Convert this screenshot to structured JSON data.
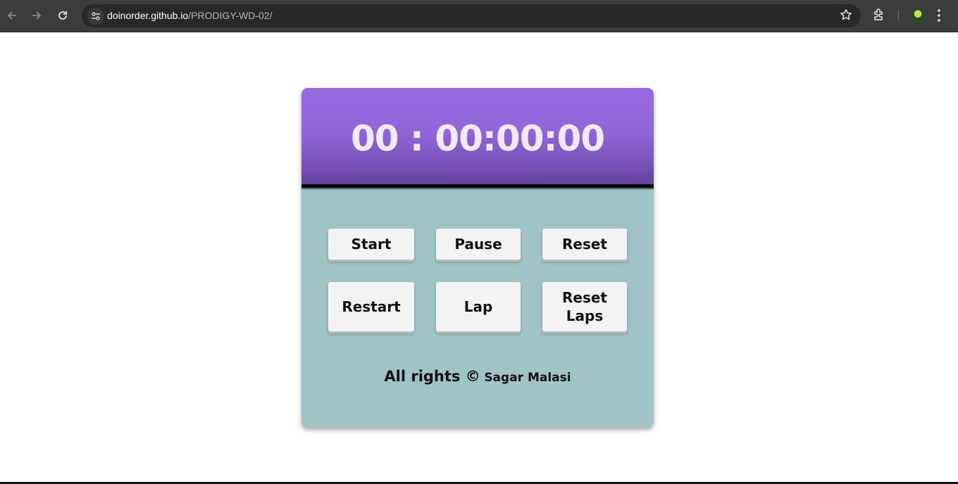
{
  "browser": {
    "url_host": "doinorder.github.io",
    "url_path": "/PRODIGY-WD-02/",
    "icons": [
      "back-arrow-icon",
      "forward-arrow-icon",
      "reload-icon",
      "site-info-icon",
      "bookmark-star-icon",
      "extensions-icon",
      "profile-avatar",
      "menu-dots-icon"
    ]
  },
  "stopwatch": {
    "time": "00 : 00:00:00",
    "buttons": {
      "start": "Start",
      "pause": "Pause",
      "reset": "Reset",
      "restart": "Restart",
      "lap": "Lap",
      "reset_laps": "Reset Laps"
    },
    "footer": {
      "rights": "All rights ©",
      "author": "Sagar Malasi"
    }
  },
  "colors": {
    "display_purple": "#9066d8",
    "card_teal": "#a0c4c6",
    "button_bg": "#f3f3f3",
    "chrome_bg": "#3c3c3c"
  }
}
